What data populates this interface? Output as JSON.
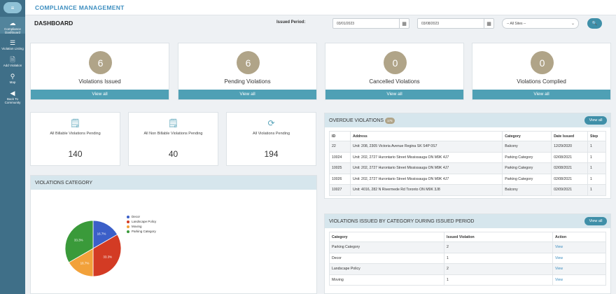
{
  "sidebar": {
    "top_icon": "≡",
    "items": [
      {
        "icon": "dashboard-icon",
        "glyph": "☁",
        "label": "Compliance\nDashboard"
      },
      {
        "icon": "list-icon",
        "glyph": "☰",
        "label": "Violation Listing"
      },
      {
        "icon": "add-document-icon",
        "glyph": "🗎",
        "label": "Add Violation"
      },
      {
        "icon": "map-icon",
        "glyph": "⚲",
        "label": "Map"
      },
      {
        "icon": "back-arrow-icon",
        "glyph": "◀",
        "label": "Back To\nCommunity"
      }
    ]
  },
  "header": {
    "app_title": "COMPLIANCE MANAGEMENT",
    "page_title": "DASHBOARD",
    "period_label": "Issued Period:",
    "date_from": "03/01/2023",
    "date_to": "03/08/2023",
    "calendar_glyph": "▦",
    "site_select": "-- All Sites --",
    "chevron_glyph": "⌄",
    "search_glyph": "🔍"
  },
  "stats": [
    {
      "value": "6",
      "label": "Violations Issued",
      "button": "View all"
    },
    {
      "value": "6",
      "label": "Pending Violations",
      "button": "View all"
    },
    {
      "value": "0",
      "label": "Cancelled Violations",
      "button": "View all"
    },
    {
      "value": "0",
      "label": "Violations Complied",
      "button": "View all"
    }
  ],
  "pending_cards": [
    {
      "icon": "billable-icon",
      "glyph": "🗒",
      "label": "All Billable Violations Pending",
      "value": "140"
    },
    {
      "icon": "non-billable-icon",
      "glyph": "🗒",
      "label": "All Non Billable Violations Pending",
      "value": "40"
    },
    {
      "icon": "refresh-icon",
      "glyph": "⟳",
      "label": "All Violations Pending",
      "value": "194"
    }
  ],
  "overdue": {
    "title": "OVERDUE VIOLATIONS",
    "count": "175",
    "button": "View all",
    "columns": [
      "ID",
      "Address",
      "Category",
      "Date Issued",
      "Step"
    ],
    "rows": [
      [
        "22",
        "Unit: 208, 2305 Victoria Avenue Regina SK S4P 0S7",
        "Balcony",
        "12/29/2020",
        "1"
      ],
      [
        "10024",
        "Unit: 202, 2727 Hurontario Street Mississauga ON M9K 4J7",
        "Parking Category",
        "02/08/2021",
        "1"
      ],
      [
        "10025",
        "Unit: 202, 2727 Hurontario Street Mississauga ON M9K 4J7",
        "Parking Category",
        "02/08/2021",
        "1"
      ],
      [
        "10026",
        "Unit: 202, 2727 Hurontario Street Mississauga ON M9K 4J7",
        "Parking Category",
        "02/08/2021",
        "1"
      ],
      [
        "10027",
        "Unit: 4016, 282 N Rivermede Rd Toronto ON M9K 3J8",
        "Balcony",
        "02/09/2021",
        "1"
      ]
    ]
  },
  "by_category": {
    "title": "VIOLATIONS ISSUED BY CATEGORY DURING ISSUED PERIOD",
    "button": "View all",
    "columns": [
      "Category",
      "Issued Violation",
      "Action"
    ],
    "rows": [
      [
        "Parking Category",
        "2",
        "View"
      ],
      [
        "Decor",
        "1",
        "View"
      ],
      [
        "Landscape Policy",
        "2",
        "View"
      ],
      [
        "Moving",
        "1",
        "View"
      ]
    ]
  },
  "category_panel": {
    "title": "VIOLATIONS CATEGORY"
  },
  "chart_data": {
    "type": "pie",
    "title": "",
    "slices": [
      {
        "name": "Decor",
        "value": 16.7,
        "label": "16.7%",
        "color": "#3b5fc8"
      },
      {
        "name": "Landscape Policy",
        "value": 33.3,
        "label": "33.3%",
        "color": "#d33b24"
      },
      {
        "name": "Moving",
        "value": 16.7,
        "label": "16.7%",
        "color": "#f2a13a"
      },
      {
        "name": "Parking Category",
        "value": 33.3,
        "label": "33.3%",
        "color": "#3a9a3a"
      }
    ],
    "legend_position": "right"
  }
}
